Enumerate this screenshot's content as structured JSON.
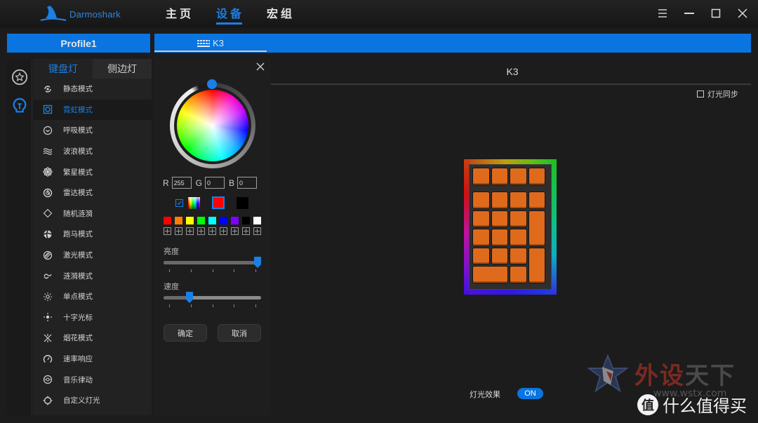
{
  "app": {
    "brand": "Darmoshark",
    "nav": [
      {
        "label": "主页",
        "active": false
      },
      {
        "label": "设备",
        "active": true
      },
      {
        "label": "宏组",
        "active": false
      }
    ],
    "window_controls": [
      "menu-icon",
      "minimize-icon",
      "maximize-icon",
      "close-icon"
    ]
  },
  "profile": {
    "label": "Profile1"
  },
  "device_tab": {
    "label": "K3",
    "icon": "keyboard-icon"
  },
  "rail": [
    {
      "icon": "star-circle-icon",
      "active": false
    },
    {
      "icon": "lightbulb-icon",
      "active": true
    }
  ],
  "lighting_tabs": [
    {
      "label": "键盘灯",
      "active": true
    },
    {
      "label": "侧边灯",
      "active": false
    }
  ],
  "modes": [
    {
      "label": "静态模式",
      "icon": "static-icon",
      "active": false
    },
    {
      "label": "霓虹模式",
      "icon": "neon-icon",
      "active": true
    },
    {
      "label": "呼吸模式",
      "icon": "breathing-icon",
      "active": false
    },
    {
      "label": "波浪模式",
      "icon": "wave-icon",
      "active": false
    },
    {
      "label": "繁星模式",
      "icon": "starry-icon",
      "active": false
    },
    {
      "label": "雷达模式",
      "icon": "radar-icon",
      "active": false
    },
    {
      "label": "随机涟漪",
      "icon": "random-ripple-icon",
      "active": false
    },
    {
      "label": "跑马模式",
      "icon": "marquee-icon",
      "active": false
    },
    {
      "label": "激光模式",
      "icon": "laser-icon",
      "active": false
    },
    {
      "label": "涟漪模式",
      "icon": "ripple-icon",
      "active": false
    },
    {
      "label": "单点模式",
      "icon": "single-point-icon",
      "active": false
    },
    {
      "label": "十字光标",
      "icon": "crosshair-icon",
      "active": false
    },
    {
      "label": "烟花模式",
      "icon": "fireworks-icon",
      "active": false
    },
    {
      "label": "速率响应",
      "icon": "speed-response-icon",
      "active": false
    },
    {
      "label": "音乐律动",
      "icon": "music-icon",
      "active": false
    },
    {
      "label": "自定义灯光",
      "icon": "custom-light-icon",
      "active": false
    }
  ],
  "color_panel": {
    "rgb": {
      "r_label": "R",
      "g_label": "G",
      "b_label": "B",
      "r": "255",
      "g": "0",
      "b": "0"
    },
    "rainbow_checked": true,
    "current_color": "#ff0000",
    "secondary_color": "#000000",
    "presets": [
      "#ff0000",
      "#ff8000",
      "#ffff00",
      "#00ff00",
      "#00ffff",
      "#0000ff",
      "#8000ff",
      "#000000",
      "#ffffff"
    ],
    "brightness": {
      "label": "亮度",
      "value_fraction": 1.0,
      "ticks": 5
    },
    "speed": {
      "label": "速度",
      "value_fraction": 0.25,
      "ticks": 5
    },
    "confirm_label": "确定",
    "cancel_label": "取消"
  },
  "main": {
    "title": "K3",
    "sync_label": "灯光同步",
    "sync_checked": false,
    "effect_label": "灯光效果",
    "effect_toggle": "ON",
    "key_color": "#e06a1c"
  },
  "watermark": {
    "brand_red": "外设",
    "brand_grey": "天下",
    "url": "www.wstx.com",
    "site_badge": "值",
    "site_name": "什么值得买"
  },
  "colors": {
    "accent": "#0a74e0",
    "background": "#1c1c1c"
  }
}
